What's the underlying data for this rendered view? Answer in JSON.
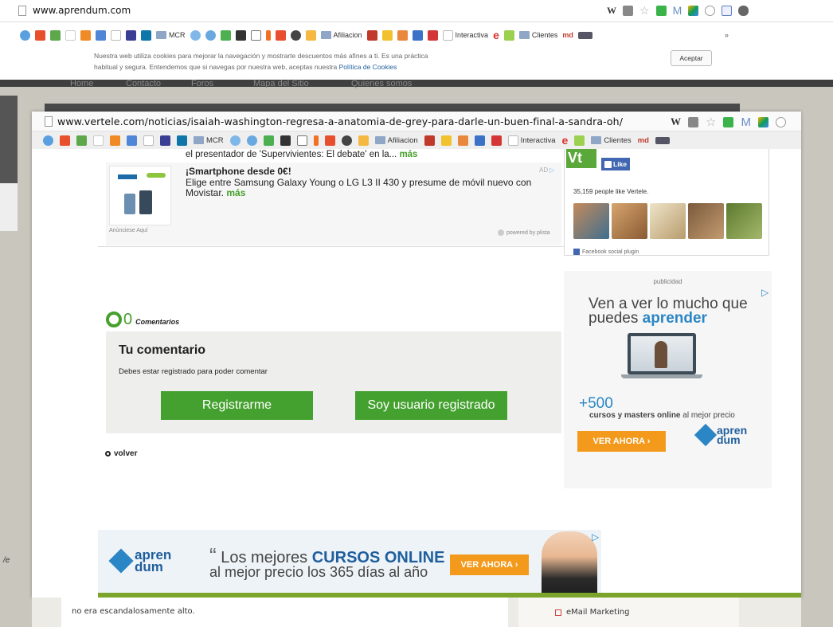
{
  "background_window": {
    "url": "www.aprendum.com",
    "bookmarks": {
      "mcr": "MCR",
      "afiliacion": "Afiliacion",
      "interactiva": "Interactiva",
      "clientes": "Clientes",
      "md": "md",
      "more": "»"
    },
    "cookie_notice": {
      "line1": "Nuestra web utiliza cookies para mejorar la navegación y mostrarte descuentos más afines a ti. Es una práctica",
      "line2_prefix": "habitual y segura. Entendemos que si navegas por nuestra web, aceptas nuestra",
      "policy_link": "Política de Cookies",
      "accept_button": "Aceptar"
    },
    "nav": [
      "Home",
      "Contacto",
      "Foros",
      "Mapa del Sitio",
      "Quienes somos"
    ],
    "left_fragment": "/e",
    "article_fragment": "no era escandalosamente alto.",
    "sidebar_item": "eMail Marketing"
  },
  "front_window": {
    "url": "www.vertele.com/noticias/isaiah-washington-regresa-a-anatomia-de-grey-para-darle-un-buen-final-a-sandra-oh/",
    "bookmarks": {
      "mcr": "MCR",
      "afiliacion": "Afiliacion",
      "interactiva": "Interactiva",
      "clientes": "Clientes",
      "md": "md"
    },
    "news_snippet": {
      "text": "el presentador de 'Supervivientes: El debate' en la...",
      "more": "más"
    },
    "ad": {
      "title": "¡Smartphone desde 0€!",
      "body": "Elige entre Samsung Galaxy Young o LG L3 II 430 y presume de móvil nuevo con Movistar.",
      "more": "más",
      "badge": "AD",
      "advertise_here": "Anúnciese Aquí",
      "powered_by": "powered by plista"
    },
    "comments": {
      "count": "0",
      "label": "Comentarios",
      "your_comment": "Tu comentario",
      "must_register": "Debes estar registrado para poder comentar",
      "register_button": "Registrarme",
      "registered_button": "Soy usuario registrado",
      "back_link": "volver"
    },
    "facebook": {
      "like_button": "Like",
      "people_like": "35,159 people like Vertele.",
      "plugin_label": "Facebook social plugin"
    },
    "right_ad": {
      "label": "publicidad",
      "headline_1": "Ven a ver lo mucho que",
      "headline_2_prefix": "puedes",
      "headline_2_emph": "aprender",
      "count": "+500",
      "courses_bold": "cursos y masters online",
      "courses_rest": "al mejor precio",
      "cta": "VER AHORA ›",
      "brand_1": "apren",
      "brand_2": "dum"
    },
    "bottom_ad": {
      "brand_1": "apren",
      "brand_2": "dum",
      "quote_open": "“",
      "text_1": "Los mejores",
      "text_emph": "CURSOS ONLINE",
      "quote_close": "„",
      "text_2": "al mejor precio los 365 días al año",
      "cta": "VER AHORA ›"
    }
  },
  "colors": {
    "green": "#45a12f",
    "orange": "#f39a1d",
    "blue": "#2b86c5",
    "dark_blue": "#1f5f9d",
    "link_green": "#46a02c"
  }
}
